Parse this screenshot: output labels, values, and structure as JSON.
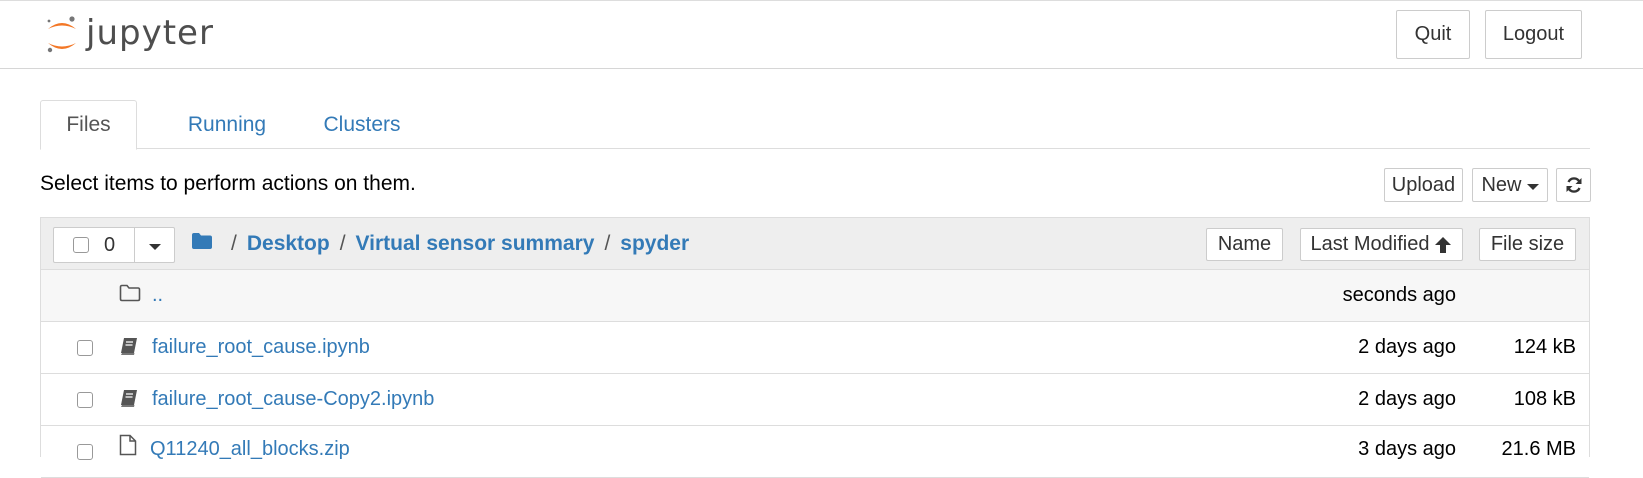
{
  "header": {
    "logo_text": "jupyter",
    "quit_label": "Quit",
    "logout_label": "Logout"
  },
  "tabs": [
    {
      "label": "Files",
      "active": true
    },
    {
      "label": "Running",
      "active": false
    },
    {
      "label": "Clusters",
      "active": false
    }
  ],
  "toolbar": {
    "hint": "Select items to perform actions on them.",
    "upload_label": "Upload",
    "new_label": "New",
    "refresh_icon": "refresh-icon"
  },
  "list": {
    "selected_count": "0",
    "breadcrumb": [
      "Desktop",
      "Virtual sensor summary",
      "spyder"
    ],
    "sort_name": "Name",
    "sort_modified": "Last Modified",
    "sort_size": "File size",
    "rows": [
      {
        "name": "..",
        "modified": "seconds ago",
        "size": "",
        "type": "parent-folder",
        "icon": "folder-icon"
      },
      {
        "name": "failure_root_cause.ipynb",
        "modified": "2 days ago",
        "size": "124 kB",
        "type": "notebook",
        "icon": "notebook-icon"
      },
      {
        "name": "failure_root_cause-Copy2.ipynb",
        "modified": "2 days ago",
        "size": "108 kB",
        "type": "notebook",
        "icon": "notebook-icon"
      },
      {
        "name": "Q11240_all_blocks.zip",
        "modified": "3 days ago",
        "size": "21.6 MB",
        "type": "file",
        "icon": "file-icon"
      }
    ]
  },
  "colors": {
    "link": "#337ab7",
    "logo_orange": "#f37726",
    "logo_gray": "#767677"
  }
}
